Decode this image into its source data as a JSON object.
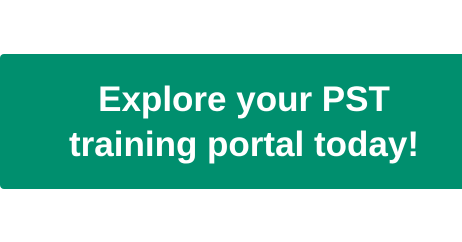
{
  "cta": {
    "label": "Explore your PST training portal today!",
    "background_color": "#008f6e",
    "text_color": "#ffffff"
  }
}
